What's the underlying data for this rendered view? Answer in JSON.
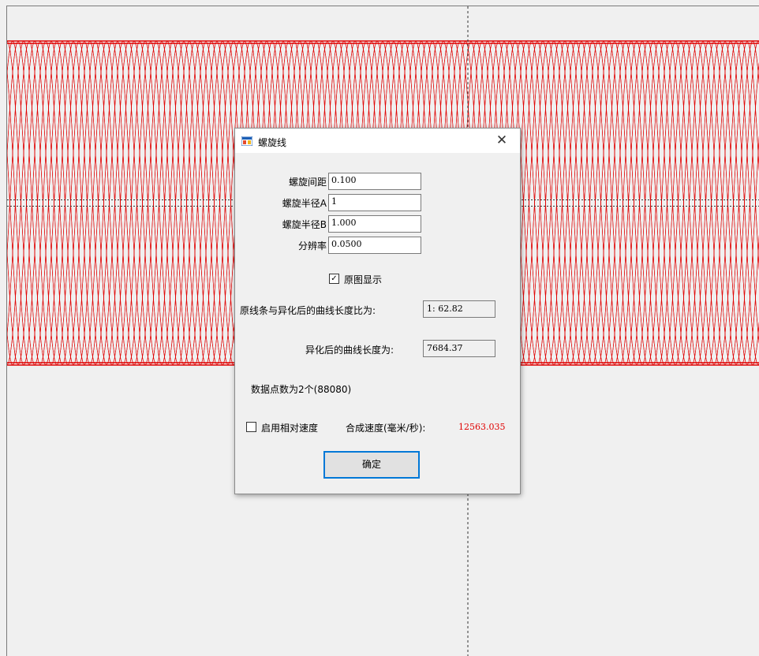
{
  "canvas": {
    "curve_color": "#e00000",
    "grid_color": "#333333"
  },
  "dialog": {
    "title": "螺旋线",
    "title_icon": "app-window-icon",
    "close_glyph": "✕",
    "fields": [
      {
        "label": "螺旋间距",
        "value": "0.100"
      },
      {
        "label": "螺旋半径A",
        "value": "1"
      },
      {
        "label": "螺旋半径B",
        "value": "1.000"
      },
      {
        "label": "分辨率",
        "value": "0.0500"
      }
    ],
    "show_original": {
      "label": "原图显示",
      "checked": true,
      "mark": "✓"
    },
    "ratio": {
      "label": "原线条与异化后的曲线长度比为:",
      "value": "1: 62.82"
    },
    "length": {
      "label": "异化后的曲线长度为:",
      "value": "7684.37"
    },
    "points_text": "数据点数为2个(88080)",
    "relative_speed": {
      "label": "启用相对速度",
      "checked": false
    },
    "speed": {
      "label": "合成速度(毫米/秒):",
      "value": "12563.035",
      "color": "#e00000"
    },
    "ok_label": "确定"
  }
}
